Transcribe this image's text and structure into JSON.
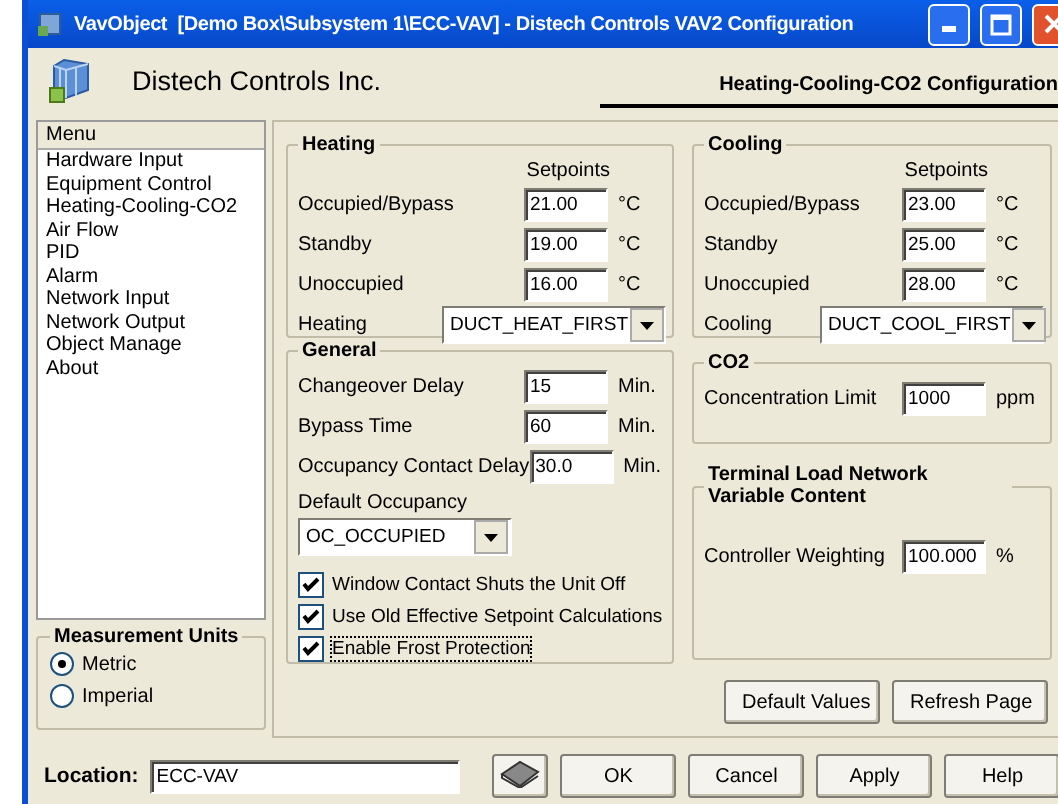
{
  "window": {
    "title": "VavObject  [Demo Box\\Subsystem 1\\ECC-VAV] - Distech Controls VAV2 Configuration"
  },
  "header": {
    "company": "Distech Controls Inc.",
    "page_title": "Heating-Cooling-CO2 Configuration"
  },
  "menu": {
    "heading": "Menu",
    "items": [
      {
        "label": "Hardware Input",
        "selected": false
      },
      {
        "label": "Equipment Control",
        "selected": false
      },
      {
        "label": "Heating-Cooling-CO2",
        "selected": false
      },
      {
        "label": "Air Flow",
        "selected": false
      },
      {
        "label": "PID",
        "selected": false
      },
      {
        "label": "Alarm",
        "selected": false
      },
      {
        "label": "Network Input",
        "selected": false
      },
      {
        "label": "Network Output",
        "selected": false
      },
      {
        "label": "Object Manage",
        "selected": false
      },
      {
        "label": "About",
        "selected": false
      }
    ]
  },
  "measurement_units": {
    "title": "Measurement Units",
    "options": [
      {
        "label": "Metric",
        "selected": true
      },
      {
        "label": "Imperial",
        "selected": false
      }
    ]
  },
  "heating": {
    "title": "Heating",
    "setpoints_label": "Setpoints",
    "rows": [
      {
        "label": "Occupied/Bypass",
        "value": "21.00",
        "unit": "°C"
      },
      {
        "label": "Standby",
        "value": "19.00",
        "unit": "°C"
      },
      {
        "label": "Unoccupied",
        "value": "16.00",
        "unit": "°C"
      }
    ],
    "mode": {
      "label": "Heating",
      "value": "DUCT_HEAT_FIRST"
    }
  },
  "general": {
    "title": "General",
    "rows": [
      {
        "label": "Changeover Delay",
        "value": "15",
        "unit": "Min."
      },
      {
        "label": "Bypass Time",
        "value": "60",
        "unit": "Min."
      },
      {
        "label": "Occupancy Contact Delay",
        "value": "30.0",
        "unit": "Min."
      }
    ],
    "default_occupancy": {
      "label": "Default Occupancy",
      "value": "OC_OCCUPIED"
    },
    "checkboxes": [
      {
        "label": "Window Contact Shuts the Unit Off",
        "checked": true,
        "focused": false
      },
      {
        "label": "Use Old Effective Setpoint Calculations",
        "checked": true,
        "focused": false
      },
      {
        "label": "Enable Frost Protection",
        "checked": true,
        "focused": true
      }
    ]
  },
  "cooling": {
    "title": "Cooling",
    "setpoints_label": "Setpoints",
    "rows": [
      {
        "label": "Occupied/Bypass",
        "value": "23.00",
        "unit": "°C"
      },
      {
        "label": "Standby",
        "value": "25.00",
        "unit": "°C"
      },
      {
        "label": "Unoccupied",
        "value": "28.00",
        "unit": "°C"
      }
    ],
    "mode": {
      "label": "Cooling",
      "value": "DUCT_COOL_FIRST"
    }
  },
  "co2": {
    "title": "CO2",
    "rows": [
      {
        "label": "Concentration Limit",
        "value": "1000",
        "unit": "ppm"
      }
    ]
  },
  "terminal_load": {
    "title": "Terminal Load Network Variable Content",
    "rows": [
      {
        "label": "Controller Weighting",
        "value": "100.000",
        "unit": "%"
      }
    ]
  },
  "panel_buttons": [
    "Default Values",
    "Refresh Page"
  ],
  "location": {
    "label": "Location:",
    "value": "ECC-VAV"
  },
  "buttons": [
    "OK",
    "Cancel",
    "Apply",
    "Help"
  ]
}
